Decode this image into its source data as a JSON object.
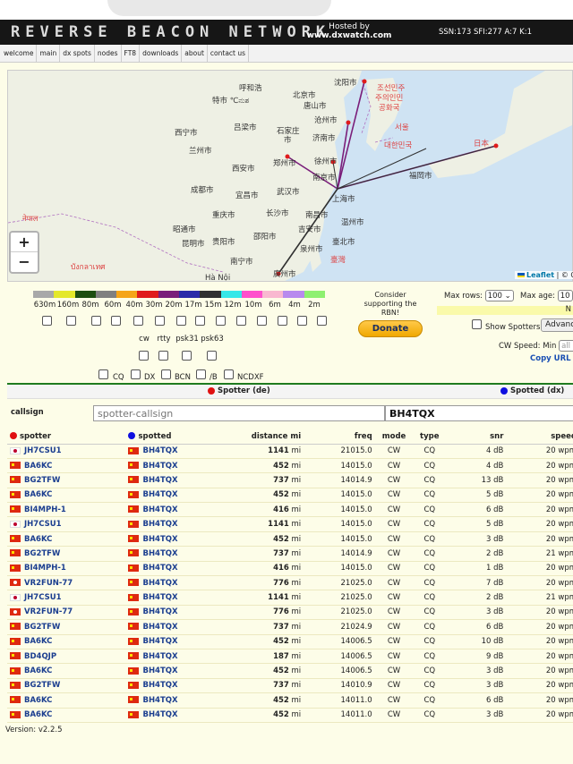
{
  "header": {
    "logo": "REVERSE BEACON NETWORK",
    "hosted_line1": "Hosted by",
    "hosted_line2": "www.dxwatch.com",
    "solar": "SSN:173 SFI:277 A:7 K:1"
  },
  "nav": [
    "welcome",
    "main",
    "dx spots",
    "nodes",
    "FT8",
    "downloads",
    "about",
    "contact us"
  ],
  "map": {
    "zoom_in": "+",
    "zoom_out": "−",
    "attribution_link": "Leaflet",
    "attribution_rest": " | © O",
    "labels": [
      "呼和浩",
      "北京市",
      "沈阳市",
      "조선민주",
      "주의인민",
      "공화국",
      "特市 ℃ನುಶ",
      "唐山市",
      "沧州市",
      "石家庄",
      "서울",
      "西宁市",
      "兰州市",
      "吕梁市",
      "济南市",
      "市",
      "대한민국",
      "日本",
      "郑州市",
      "徐州市",
      "西安市",
      "南京市",
      "福岡市",
      "成都市",
      "宜昌市",
      "武汉市",
      "上海市",
      "नेपाल",
      "重庆市",
      "长沙市",
      "南昌市",
      "温州市",
      "昭通市",
      "昆明市",
      "贵阳市",
      "邵阳市",
      "吉安市",
      "泉州市",
      "臺北市",
      "南宁市",
      "廣州市",
      "臺灣",
      "Hà Nội",
      "บังกลาเทศ",
      "ल"
    ]
  },
  "bands": {
    "labels": [
      "630m",
      "160m",
      "80m",
      "60m",
      "40m",
      "30m",
      "20m",
      "17m",
      "15m",
      "12m",
      "10m",
      "6m",
      "4m",
      "2m"
    ],
    "colors": [
      "#a9a9a9",
      "#e4e82a",
      "#1d4e10",
      "#808080",
      "#f5a518",
      "#e01b1b",
      "#7a1e7a",
      "#2b2ba8",
      "#303030",
      "#35e8e8",
      "#ff50cc",
      "#f9b8d0",
      "#b88aee",
      "#8ef070"
    ]
  },
  "modes": [
    "cw",
    "rtty",
    "psk31",
    "psk63"
  ],
  "filters": [
    "CQ",
    "DX",
    "BCN",
    "/B",
    "NCDXF"
  ],
  "donate": {
    "consider": "Consider supporting the RBN!",
    "button": "Donate"
  },
  "controls": {
    "max_rows_label": "Max rows:",
    "max_rows_value": "100",
    "max_age_label": "Max age:",
    "max_age_value": "10",
    "yellow_note": "N",
    "show_spotters": "Show Spotters",
    "advanced": "Advanc",
    "cw_speed_label": "CW Speed:",
    "cw_speed_min": "Min",
    "cw_speed_all": "all",
    "copy_url": "Copy URL t"
  },
  "table_filter": {
    "spotter_header": "Spotter (de)",
    "spotted_header": "Spotted (dx)",
    "callsign_label": "callsign",
    "spotter_placeholder": "spotter-callsign",
    "spotted_value": "BH4TQX"
  },
  "columns": [
    "spotter",
    "spotted",
    "distance mi",
    "freq",
    "mode",
    "type",
    "snr",
    "speed"
  ],
  "rows": [
    {
      "spotter": "JH7CSU1",
      "sflag": "jp",
      "spotted": "BH4TQX",
      "dist": "1141",
      "freq": "21015.0",
      "mode": "CW",
      "type": "CQ",
      "snr": "4 dB",
      "speed": "20 wpm"
    },
    {
      "spotter": "BA6KC",
      "sflag": "cn",
      "spotted": "BH4TQX",
      "dist": "452",
      "freq": "14015.0",
      "mode": "CW",
      "type": "CQ",
      "snr": "4 dB",
      "speed": "20 wpm"
    },
    {
      "spotter": "BG2TFW",
      "sflag": "cn",
      "spotted": "BH4TQX",
      "dist": "737",
      "freq": "14014.9",
      "mode": "CW",
      "type": "CQ",
      "snr": "13 dB",
      "speed": "20 wpm"
    },
    {
      "spotter": "BA6KC",
      "sflag": "cn",
      "spotted": "BH4TQX",
      "dist": "452",
      "freq": "14015.0",
      "mode": "CW",
      "type": "CQ",
      "snr": "5 dB",
      "speed": "20 wpm"
    },
    {
      "spotter": "BI4MPH-1",
      "sflag": "cn",
      "spotted": "BH4TQX",
      "dist": "416",
      "freq": "14015.0",
      "mode": "CW",
      "type": "CQ",
      "snr": "6 dB",
      "speed": "20 wpm"
    },
    {
      "spotter": "JH7CSU1",
      "sflag": "jp",
      "spotted": "BH4TQX",
      "dist": "1141",
      "freq": "14015.0",
      "mode": "CW",
      "type": "CQ",
      "snr": "5 dB",
      "speed": "20 wpm"
    },
    {
      "spotter": "BA6KC",
      "sflag": "cn",
      "spotted": "BH4TQX",
      "dist": "452",
      "freq": "14015.0",
      "mode": "CW",
      "type": "CQ",
      "snr": "3 dB",
      "speed": "20 wpm"
    },
    {
      "spotter": "BG2TFW",
      "sflag": "cn",
      "spotted": "BH4TQX",
      "dist": "737",
      "freq": "14014.9",
      "mode": "CW",
      "type": "CQ",
      "snr": "2 dB",
      "speed": "21 wpm"
    },
    {
      "spotter": "BI4MPH-1",
      "sflag": "cn",
      "spotted": "BH4TQX",
      "dist": "416",
      "freq": "14015.0",
      "mode": "CW",
      "type": "CQ",
      "snr": "1 dB",
      "speed": "20 wpm"
    },
    {
      "spotter": "VR2FUN-77",
      "sflag": "hk",
      "spotted": "BH4TQX",
      "dist": "776",
      "freq": "21025.0",
      "mode": "CW",
      "type": "CQ",
      "snr": "7 dB",
      "speed": "20 wpm"
    },
    {
      "spotter": "JH7CSU1",
      "sflag": "jp",
      "spotted": "BH4TQX",
      "dist": "1141",
      "freq": "21025.0",
      "mode": "CW",
      "type": "CQ",
      "snr": "2 dB",
      "speed": "21 wpm"
    },
    {
      "spotter": "VR2FUN-77",
      "sflag": "hk",
      "spotted": "BH4TQX",
      "dist": "776",
      "freq": "21025.0",
      "mode": "CW",
      "type": "CQ",
      "snr": "3 dB",
      "speed": "20 wpm"
    },
    {
      "spotter": "BG2TFW",
      "sflag": "cn",
      "spotted": "BH4TQX",
      "dist": "737",
      "freq": "21024.9",
      "mode": "CW",
      "type": "CQ",
      "snr": "6 dB",
      "speed": "20 wpm"
    },
    {
      "spotter": "BA6KC",
      "sflag": "cn",
      "spotted": "BH4TQX",
      "dist": "452",
      "freq": "14006.5",
      "mode": "CW",
      "type": "CQ",
      "snr": "10 dB",
      "speed": "20 wpm"
    },
    {
      "spotter": "BD4QJP",
      "sflag": "cn",
      "spotted": "BH4TQX",
      "dist": "187",
      "freq": "14006.5",
      "mode": "CW",
      "type": "CQ",
      "snr": "9 dB",
      "speed": "20 wpm"
    },
    {
      "spotter": "BA6KC",
      "sflag": "cn",
      "spotted": "BH4TQX",
      "dist": "452",
      "freq": "14006.5",
      "mode": "CW",
      "type": "CQ",
      "snr": "3 dB",
      "speed": "20 wpm"
    },
    {
      "spotter": "BG2TFW",
      "sflag": "cn",
      "spotted": "BH4TQX",
      "dist": "737",
      "freq": "14010.9",
      "mode": "CW",
      "type": "CQ",
      "snr": "3 dB",
      "speed": "20 wpm"
    },
    {
      "spotter": "BA6KC",
      "sflag": "cn",
      "spotted": "BH4TQX",
      "dist": "452",
      "freq": "14011.0",
      "mode": "CW",
      "type": "CQ",
      "snr": "6 dB",
      "speed": "20 wpm"
    },
    {
      "spotter": "BA6KC",
      "sflag": "cn",
      "spotted": "BH4TQX",
      "dist": "452",
      "freq": "14011.0",
      "mode": "CW",
      "type": "CQ",
      "snr": "3 dB",
      "speed": "20 wpm"
    }
  ],
  "unit_mi": "mi",
  "version": "Version: v2.2.5"
}
